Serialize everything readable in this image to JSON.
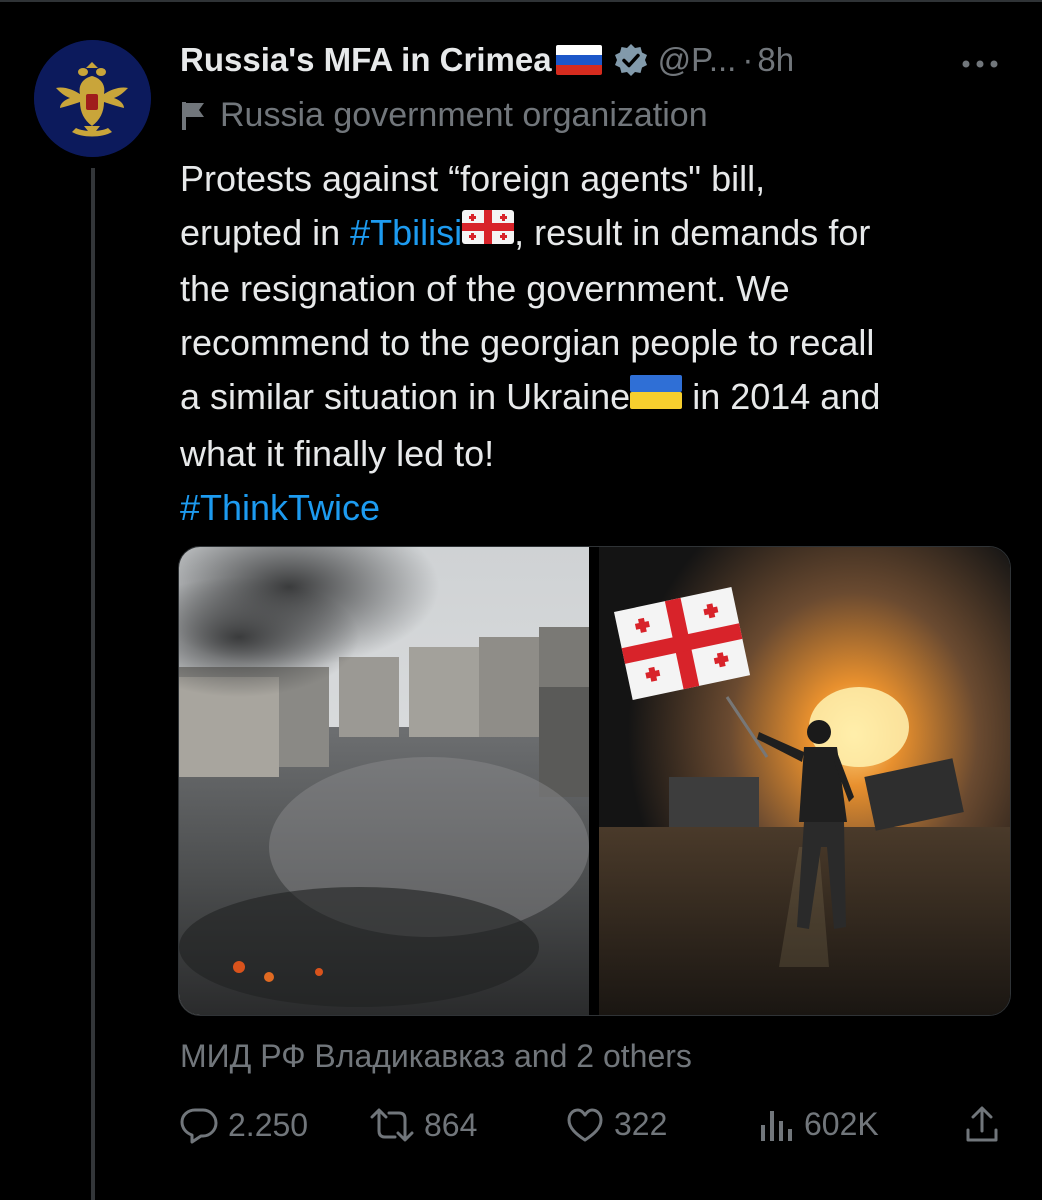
{
  "author": {
    "name": "Russia's MFA in Crimea",
    "handle": "@P...",
    "separator": "·",
    "time": "8h",
    "label": "Russia government organization"
  },
  "tweet": {
    "lines": [
      [
        {
          "text": "Protests against “foreign agents\" bill,"
        }
      ],
      [
        {
          "text": "erupted in "
        },
        {
          "text": "#Tbilisi",
          "hashtag": true
        },
        {
          "emoji": "flag-georgia"
        },
        {
          "text": ", result in demands for"
        }
      ],
      [
        {
          "text": "the resignation of the government. We"
        }
      ],
      [
        {
          "text": "recommend to the georgian people to recall"
        }
      ],
      [
        {
          "text": "a similar situation in Ukraine"
        },
        {
          "emoji": "flag-ukraine"
        },
        {
          "text": " in 2014 and"
        }
      ],
      [
        {
          "text": "what it finally led to!"
        }
      ],
      [
        {
          "text": "#ThinkTwice",
          "hashtag": true
        }
      ]
    ]
  },
  "media": {
    "left_image": "smoke-over-city-square-photo",
    "right_image": "man-with-georgian-flag-burning-car-photo"
  },
  "liked_by": "МИД РФ Владикавказ and 2 others",
  "actions": {
    "replies": "2.250",
    "reposts": "864",
    "likes": "322",
    "views": "602K"
  },
  "icons": [
    "more-icon",
    "flag-icon",
    "verified-badge-icon",
    "reply-icon",
    "repost-icon",
    "like-icon",
    "views-icon",
    "share-icon"
  ],
  "colors": {
    "accent": "#1d9bf0",
    "muted": "#71767b",
    "text": "#e7e9ea",
    "background": "#000000"
  }
}
